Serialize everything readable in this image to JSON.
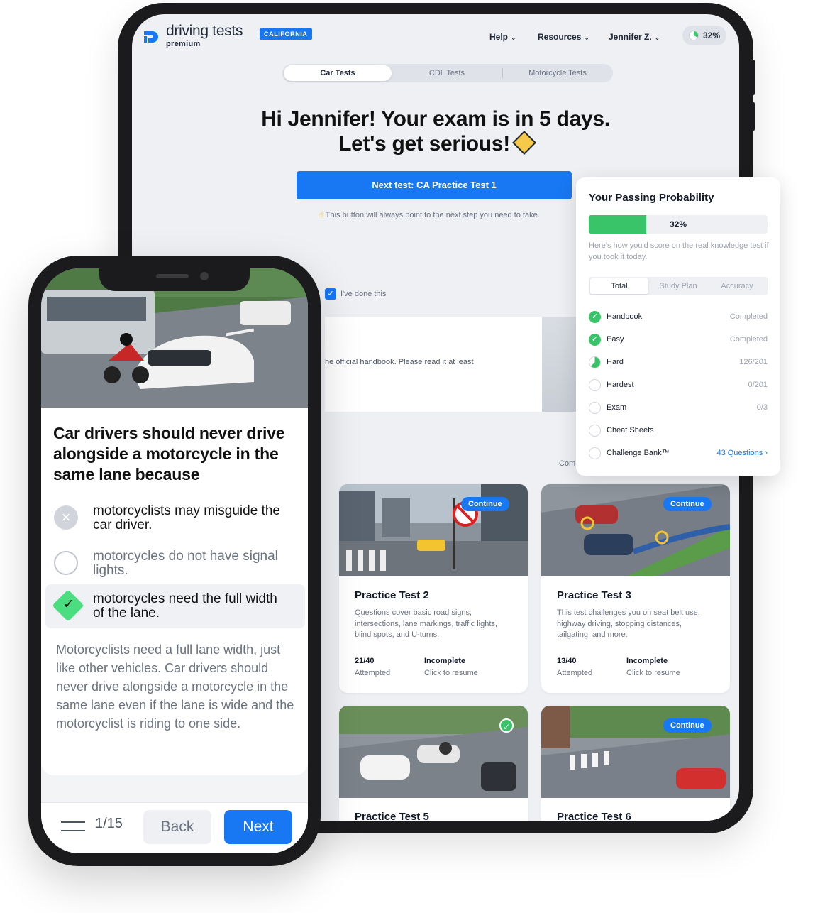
{
  "tablet": {
    "brand": {
      "name": "driving tests",
      "tier": "premium",
      "state": "CALIFORNIA"
    },
    "nav": {
      "help": "Help",
      "resources": "Resources",
      "user": "Jennifer Z.",
      "progress": "32%"
    },
    "tabs": [
      {
        "label": "Car Tests"
      },
      {
        "label": "CDL Tests"
      },
      {
        "label": "Motorcycle Tests"
      }
    ],
    "hero": {
      "line1": "Hi Jennifer! Your exam is in 5 days.",
      "line2": "Let's get serious!"
    },
    "next_button": "Next test: CA Practice Test 1",
    "hint": "This button will always point to the next step you need to take.",
    "done_label": "I've done this",
    "handbook_text": "he official handbook. Please read it at least",
    "com_label": "Com",
    "tests": [
      {
        "continue": "Continue",
        "title": "Practice Test 2",
        "desc": "Questions cover basic road signs, intersections, lane markings, traffic lights, blind spots, and U-turns.",
        "attempted": "21/40",
        "attempted_label": "Attempted",
        "status": "Incomplete",
        "status_label": "Click to resume"
      },
      {
        "continue": "Continue",
        "title": "Practice Test 3",
        "desc": "This test challenges you on seat belt use, highway driving, stopping distances, tailgating, and more.",
        "attempted": "13/40",
        "attempted_label": "Attempted",
        "status": "Incomplete",
        "status_label": "Click to resume"
      },
      {
        "title": "Practice Test 5"
      },
      {
        "continue": "Continue",
        "title": "Practice Test 6"
      }
    ]
  },
  "probability": {
    "title": "Your Passing Probability",
    "percent_label": "32%",
    "percent_value": 0.32,
    "desc": "Here's how you'd score on the real knowledge test if you took it today.",
    "tabs": [
      "Total",
      "Study Plan",
      "Accuracy"
    ],
    "rows": [
      {
        "name": "Handbook",
        "value": "Completed",
        "state": "done"
      },
      {
        "name": "Easy",
        "value": "Completed",
        "state": "done"
      },
      {
        "name": "Hard",
        "value": "126/201",
        "state": "part"
      },
      {
        "name": "Hardest",
        "value": "0/201",
        "state": "none"
      },
      {
        "name": "Exam",
        "value": "0/3",
        "state": "none"
      },
      {
        "name": "Cheat Sheets",
        "value": "",
        "state": "none"
      },
      {
        "name": "Challenge Bank™",
        "value": "43 Questions ›",
        "state": "none",
        "link": true
      }
    ]
  },
  "phone": {
    "question": "Car drivers should never drive alongside a motorcycle in the same lane because",
    "answers": [
      {
        "text": "motorcyclists may misguide the car driver.",
        "state": "wrong"
      },
      {
        "text": "motorcycles do not have signal lights.",
        "state": "empty"
      },
      {
        "text": "motorcycles need the full width of the lane.",
        "state": "correct"
      }
    ],
    "explanation": "Motorcyclists need a full lane width, just like other vehicles. Car drivers should never drive alongside a motorcycle in the same lane even if the lane is wide and the motorcyclist is riding to one side.",
    "counter": "1/15",
    "back": "Back",
    "next": "Next"
  },
  "colors": {
    "brand_blue": "#1877f2",
    "success_green": "#3ac46a",
    "text_dark": "#111827",
    "muted": "#6b7280"
  }
}
